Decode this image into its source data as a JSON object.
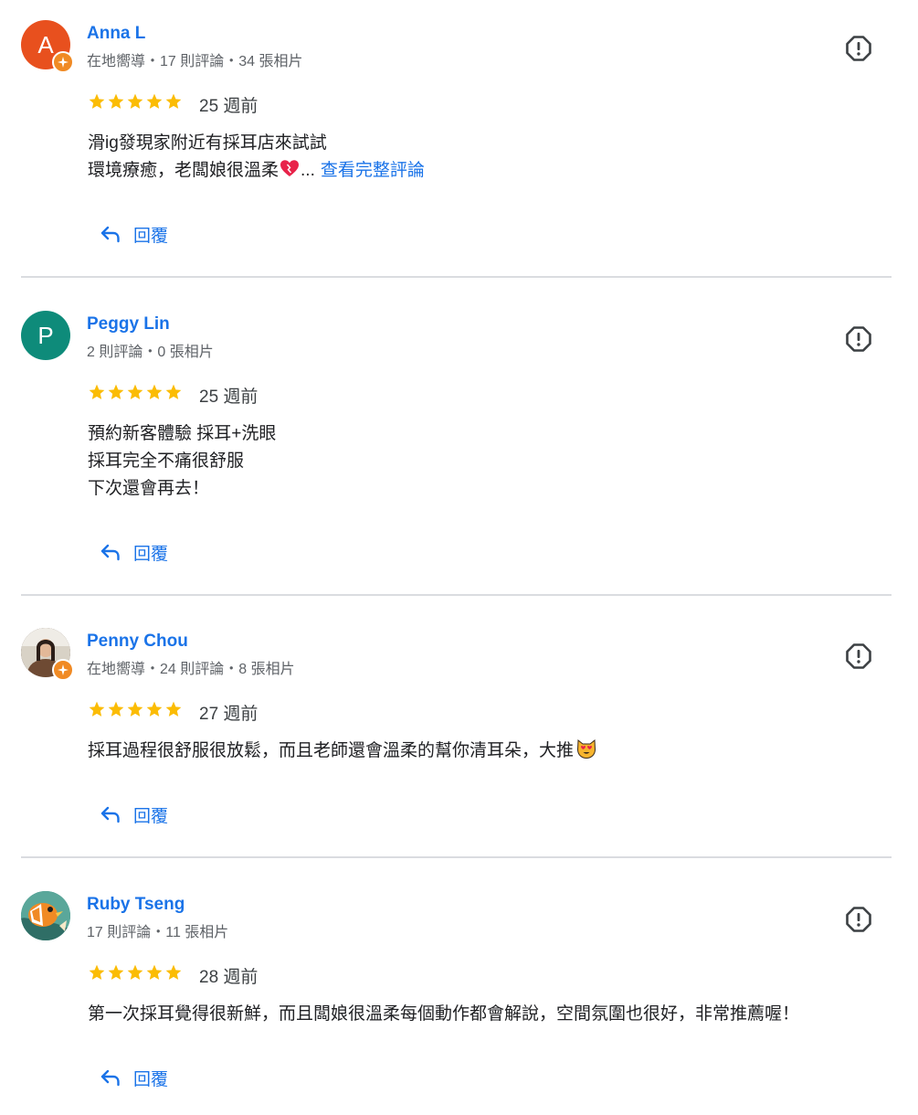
{
  "colors": {
    "accent": "#1a73e8",
    "star": "#fbbc04",
    "divider": "#dadce0"
  },
  "reply_label": "回覆",
  "reviews": [
    {
      "name": "Anna L",
      "avatar_letter": "A",
      "avatar_color": "#e8501e",
      "local_guide": true,
      "meta": "在地嚮導・17 則評論・34 張相片",
      "rating": 5,
      "date": "25 週前",
      "lines": [
        "滑ig發現家附近有採耳店來試試",
        "環境療癒，老闆娘很溫柔"
      ],
      "line_end_emoji": "heart-emoji",
      "ellipsis": "...",
      "more_label": "查看完整評論"
    },
    {
      "name": "Peggy Lin",
      "avatar_letter": "P",
      "avatar_color": "#0e8b7a",
      "local_guide": false,
      "meta": "2 則評論・0 張相片",
      "rating": 5,
      "date": "25 週前",
      "lines": [
        "預約新客體驗 採耳+洗眼",
        "採耳完全不痛很舒服",
        "下次還會再去！"
      ]
    },
    {
      "name": "Penny Chou",
      "avatar_letter": "",
      "avatar_color": "#6b5a4e",
      "local_guide": true,
      "meta": "在地嚮導・24 則評論・8 張相片",
      "rating": 5,
      "date": "27 週前",
      "lines": [
        "採耳過程很舒服很放鬆，而且老師還會溫柔的幫你清耳朵，大推"
      ],
      "line_end_emoji": "heart-eyes-cat-emoji"
    },
    {
      "name": "Ruby Tseng",
      "avatar_letter": "",
      "avatar_color": "#3c8a82",
      "local_guide": false,
      "meta": "17 則評論・11 張相片",
      "rating": 5,
      "date": "28 週前",
      "lines": [
        "第一次採耳覺得很新鮮，而且闆娘很溫柔每個動作都會解說，空間氛圍也很好，非常推薦喔！"
      ]
    }
  ]
}
